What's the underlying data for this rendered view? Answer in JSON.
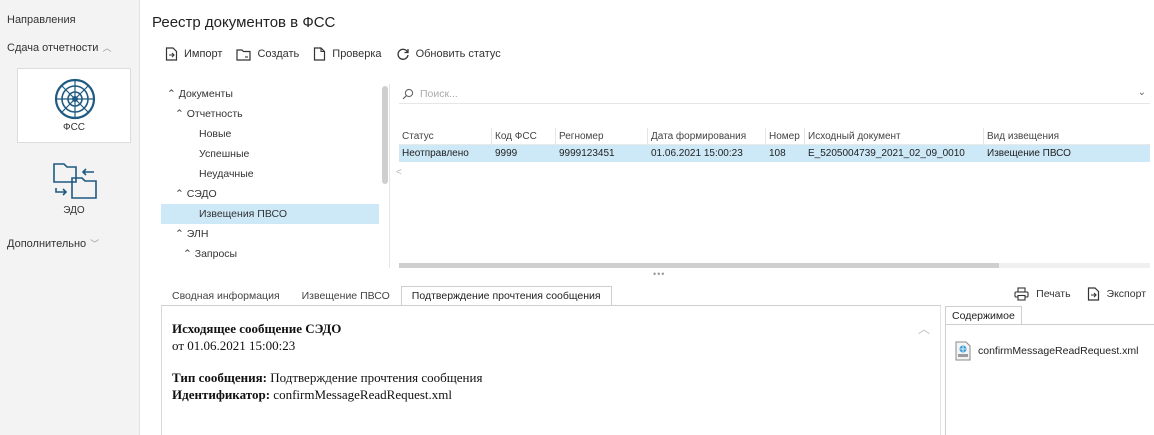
{
  "nav": {
    "directions": "Направления",
    "submit_reports": "Сдача отчетности",
    "tiles": [
      {
        "label": "ФСС",
        "active": true,
        "icon": "fss-emblem-icon"
      },
      {
        "label": "ЭДО",
        "active": false,
        "icon": "folders-exchange-icon"
      }
    ],
    "additional": "Дополнительно"
  },
  "page_title": "Реестр документов в ФСС",
  "toolbar": {
    "import": "Импорт",
    "create": "Создать",
    "check": "Проверка",
    "refresh_status": "Обновить статус"
  },
  "tree": [
    {
      "label": "Документы",
      "expanded": true,
      "level": 0
    },
    {
      "label": "Отчетность",
      "expanded": true,
      "level": 1
    },
    {
      "label": "Новые",
      "level": 2
    },
    {
      "label": "Успешные",
      "level": 2
    },
    {
      "label": "Неудачные",
      "level": 2
    },
    {
      "label": "СЭДО",
      "expanded": true,
      "level": 1
    },
    {
      "label": "Извещения ПВСО",
      "level": 2,
      "selected": true
    },
    {
      "label": "ЭЛН",
      "expanded": true,
      "level": 1
    },
    {
      "label": "Запросы",
      "expanded": true,
      "level": 2
    }
  ],
  "search": {
    "placeholder": "Поиск..."
  },
  "grid": {
    "columns": [
      "Статус",
      "Код ФСС",
      "Регномер",
      "Дата формирования",
      "Номер",
      "Исходный документ",
      "Вид извещения"
    ],
    "rows": [
      [
        "Неотправлено",
        "9999",
        "9999123451",
        "01.06.2021 15:00:23",
        "108",
        "E_5205004739_2021_02_09_0010",
        "Извещение ПВСО"
      ]
    ]
  },
  "bottom_tabs": [
    {
      "label": "Сводная информация",
      "active": false
    },
    {
      "label": "Извещение ПВСО",
      "active": false
    },
    {
      "label": "Подтверждение прочтения сообщения",
      "active": true
    }
  ],
  "actions": {
    "print": "Печать",
    "export": "Экспорт"
  },
  "message": {
    "heading": "Исходящее сообщение СЭДО",
    "date_line": "от 01.06.2021 15:00:23",
    "type_label": "Тип сообщения:",
    "type_value": "Подтверждение прочтения сообщения",
    "id_label": "Идентификатор:",
    "id_value": "confirmMessageReadRequest.xml"
  },
  "contents": {
    "tab_label": "Содержимое",
    "files": [
      "confirmMessageReadRequest.xml"
    ]
  },
  "colors": {
    "selection": "#cde8f6",
    "accent": "#1e88c8"
  }
}
